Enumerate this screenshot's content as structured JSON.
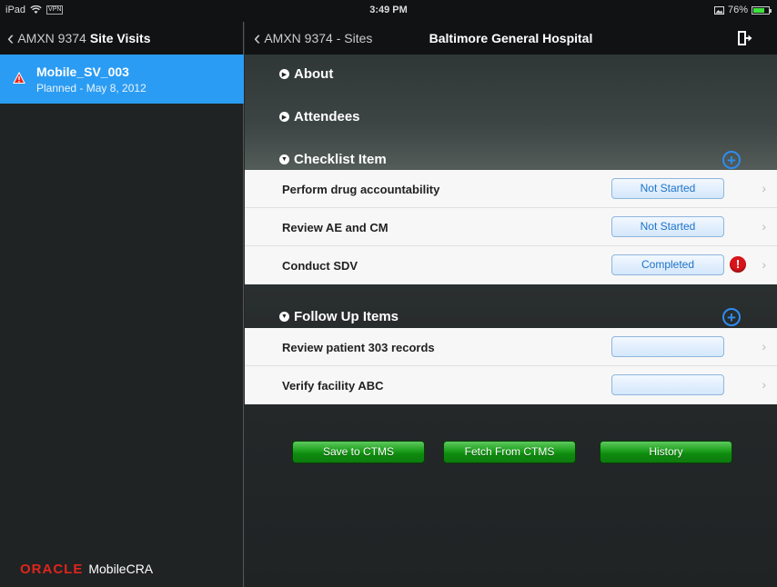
{
  "status_bar": {
    "device": "iPad",
    "vpn": "VPN",
    "time": "3:49 PM",
    "battery": "76%",
    "battery_level": 0.76
  },
  "left_pane": {
    "back_label": "AMXN 9374",
    "title": "Site Visits",
    "selected_visit": {
      "name": "Mobile_SV_003",
      "subtitle": "Planned - May 8, 2012"
    },
    "footer": {
      "brand": "ORACLE",
      "product": "MobileCRA"
    }
  },
  "right_pane": {
    "back_label": "AMXN 9374 - Sites",
    "title": "Baltimore General Hospital",
    "sections": {
      "about": "About",
      "attendees": "Attendees",
      "checklist": "Checklist Item",
      "follow_up": "Follow Up Items"
    },
    "checklist_items": [
      {
        "label": "Perform drug accountability",
        "status": "Not Started"
      },
      {
        "label": "Review AE and CM",
        "status": "Not Started"
      },
      {
        "label": "Conduct SDV",
        "status": "Completed",
        "alert": "!"
      }
    ],
    "follow_up_items": [
      {
        "label": "Review patient 303 records",
        "status": ""
      },
      {
        "label": "Verify facility ABC",
        "status": ""
      }
    ],
    "buttons": {
      "save": "Save to CTMS",
      "fetch": "Fetch From CTMS",
      "history": "History"
    }
  },
  "colors": {
    "accent_blue": "#2b9cf3",
    "button_green": "#22a422",
    "alert_red": "#d8141b",
    "oracle_red": "#e0251b"
  }
}
